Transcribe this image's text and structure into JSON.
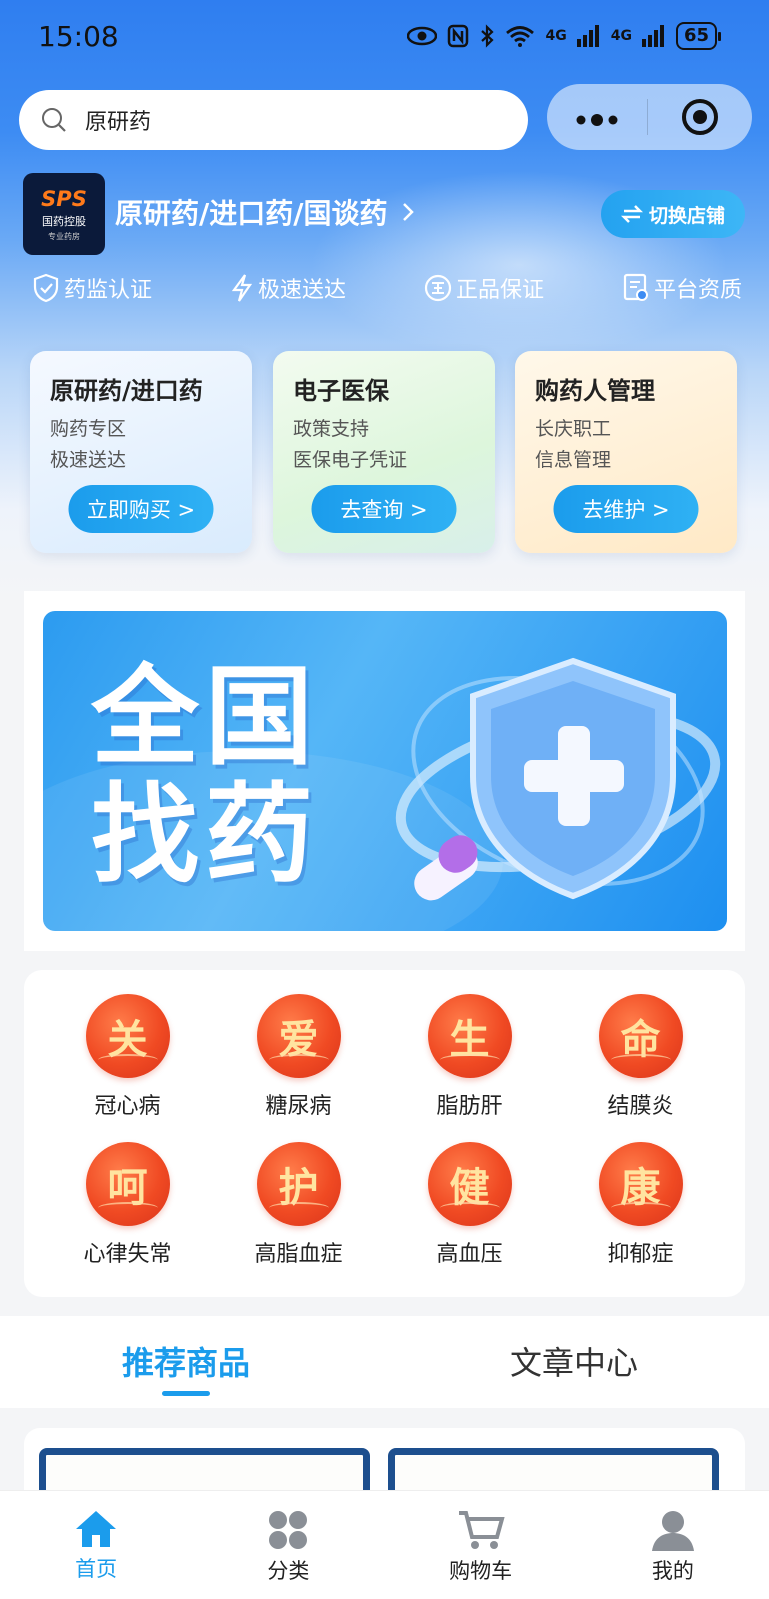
{
  "status_bar": {
    "time": "15:08",
    "battery": "65",
    "network1": "4G",
    "network2": "4G"
  },
  "search": {
    "query": "原研药"
  },
  "store": {
    "name": "原研药/进口药/国谈药",
    "switch_label": "切换店铺",
    "logo_text": "SPS",
    "logo_cn": "国药控股",
    "logo_sub": "专业药房"
  },
  "features": [
    {
      "icon": "shield-check-icon",
      "label": "药监认证"
    },
    {
      "icon": "lightning-icon",
      "label": "极速送达"
    },
    {
      "icon": "genuine-badge-icon",
      "label": "正品保证"
    },
    {
      "icon": "certificate-icon",
      "label": "平台资质"
    }
  ],
  "cards": [
    {
      "title": "原研药/进口药",
      "line1": "购药专区",
      "line2": "极速送达",
      "button": "立即购买 >"
    },
    {
      "title": "电子医保",
      "line1": "政策支持",
      "line2": "医保电子凭证",
      "button": "去查询 >"
    },
    {
      "title": "购药人管理",
      "line1": "长庆职工",
      "line2": "信息管理",
      "button": "去维护 >"
    }
  ],
  "banner": {
    "title_line1": "全国",
    "title_line2": "找药"
  },
  "diseases": [
    {
      "glyph": "关",
      "label": "冠心病"
    },
    {
      "glyph": "爱",
      "label": "糖尿病"
    },
    {
      "glyph": "生",
      "label": "脂肪肝"
    },
    {
      "glyph": "命",
      "label": "结膜炎"
    },
    {
      "glyph": "呵",
      "label": "心律失常"
    },
    {
      "glyph": "护",
      "label": "高脂血症"
    },
    {
      "glyph": "健",
      "label": "高血压"
    },
    {
      "glyph": "康",
      "label": "抑郁症"
    }
  ],
  "tabs": [
    {
      "label": "推荐商品",
      "active": true
    },
    {
      "label": "文章中心",
      "active": false
    }
  ],
  "bottom_nav": [
    {
      "icon": "home-icon",
      "label": "首页",
      "active": true
    },
    {
      "icon": "category-icon",
      "label": "分类",
      "active": false
    },
    {
      "icon": "cart-icon",
      "label": "购物车",
      "active": false
    },
    {
      "icon": "profile-icon",
      "label": "我的",
      "active": false
    }
  ],
  "colors": {
    "accent": "#1b9cec",
    "header_blue": "#2f7ef0",
    "disease_red": "#f04a23"
  }
}
